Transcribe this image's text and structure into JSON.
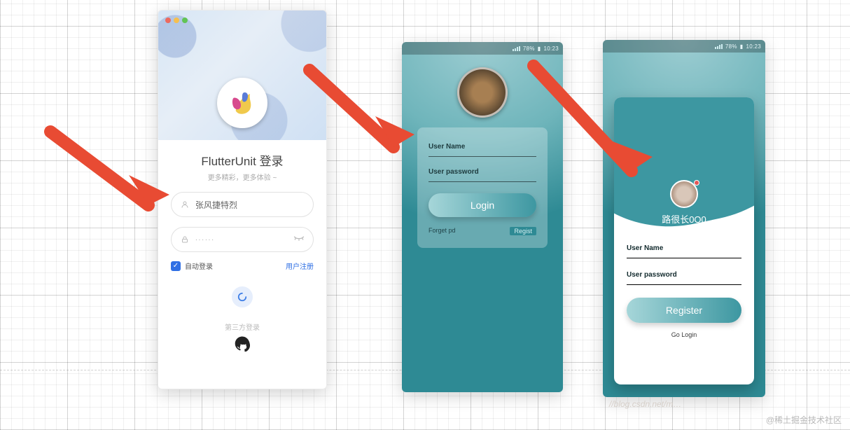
{
  "statusbar": {
    "battery": "78%",
    "time": "10:23"
  },
  "phone1": {
    "title": "FlutterUnit 登录",
    "subtitle": "更多精彩，更多体验 ~",
    "username_value": "张风捷特烈",
    "password_masked": "······",
    "auto_login_label": "自动登录",
    "register_link": "用户注册",
    "third_party_label": "第三方登录"
  },
  "phone2": {
    "avatar_label": "league-avatar",
    "username_label": "User Name",
    "password_label": "User password",
    "login_button": "Login",
    "forget_link": "Forget pd",
    "register_link": "Regist"
  },
  "phone3": {
    "display_name": "路很长0O0",
    "username_label": "User Name",
    "password_label": "User password",
    "register_button": "Register",
    "go_login_link": "Go Login"
  },
  "watermark_right": "@稀土掘金技术社区",
  "watermark_faded": "//blog.csdn.net/m…"
}
